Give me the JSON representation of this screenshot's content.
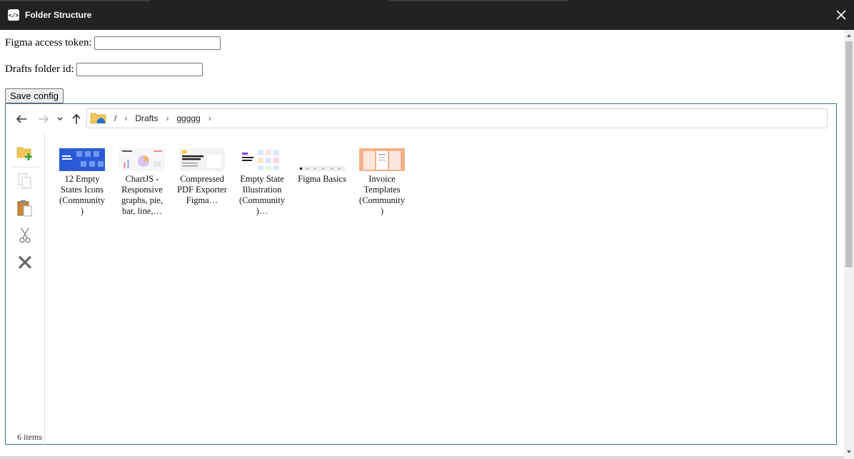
{
  "window": {
    "title": "Folder Structure",
    "app_icon_glyph": "</>",
    "close_icon": "close-icon"
  },
  "config": {
    "token_label": "Figma access token:",
    "token_value": "",
    "folder_label": "Drafts folder id:",
    "folder_value": "",
    "save_label": "Save config"
  },
  "breadcrumb": {
    "root": "/",
    "items": [
      "Drafts",
      "ggggg"
    ]
  },
  "files": [
    {
      "name": "12 Empty States Icons (Community )"
    },
    {
      "name": "ChartJS - Responsive graphs, pie, bar, line,…"
    },
    {
      "name": "Compressed PDF Exporter Figma…"
    },
    {
      "name": "Empty State Illustration (Community )…"
    },
    {
      "name": "Figma Basics"
    },
    {
      "name": "Invoice Templates (Community )"
    }
  ],
  "status": {
    "item_count": "6 items"
  },
  "colors": {
    "titlebar": "#222222",
    "border_accent": "#3a6f8f",
    "add_folder_green": "#2e9e3e",
    "delete_gray": "#666666"
  }
}
